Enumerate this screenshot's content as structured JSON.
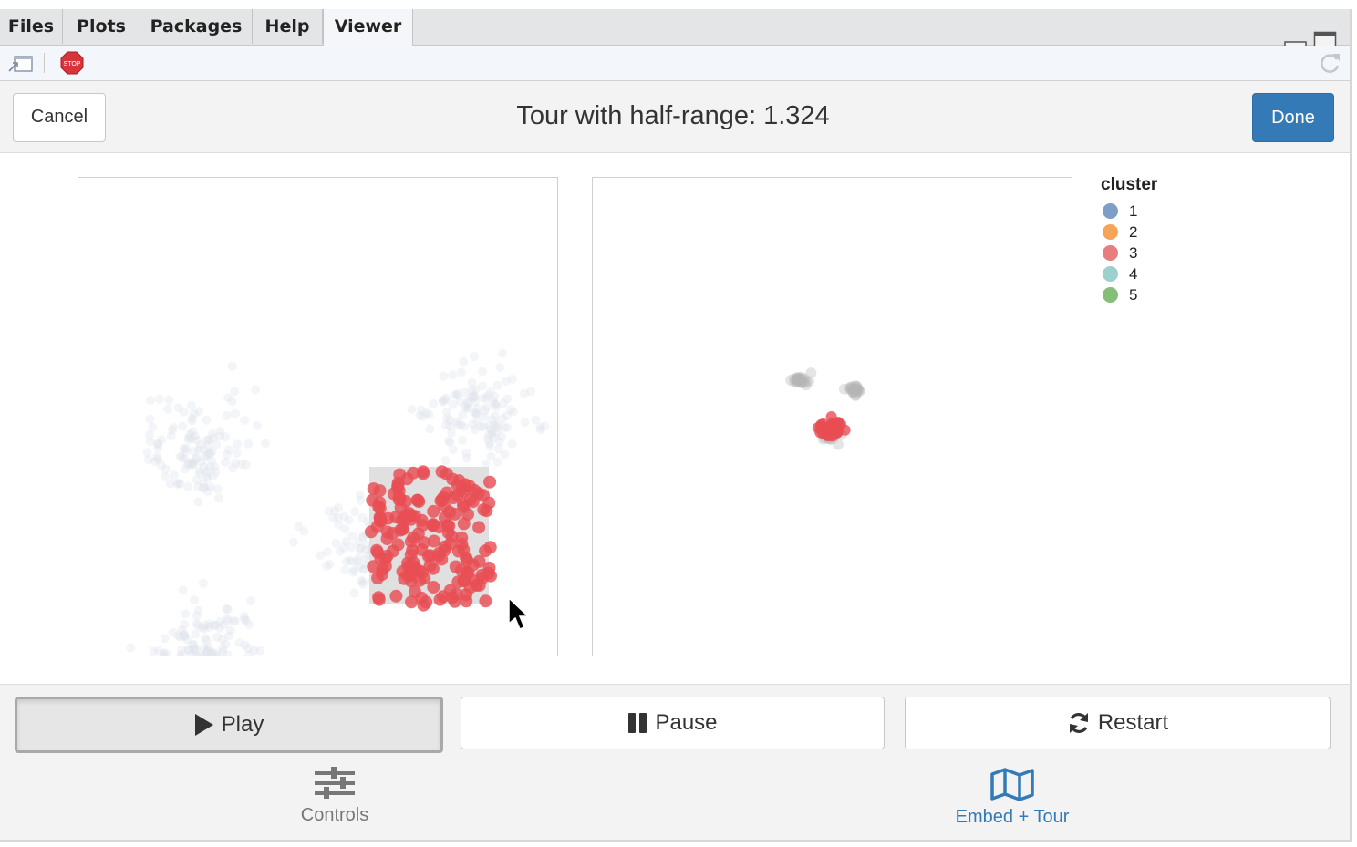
{
  "tabs": [
    {
      "label": "Files"
    },
    {
      "label": "Plots"
    },
    {
      "label": "Packages"
    },
    {
      "label": "Help"
    },
    {
      "label": "Viewer",
      "active": true
    }
  ],
  "toolbar": {
    "stop_icon": "stop-sign-icon",
    "stop_text": "STOP",
    "refresh_icon": "refresh-icon"
  },
  "header": {
    "cancel_label": "Cancel",
    "title": "Tour with half-range: 1.324",
    "done_label": "Done"
  },
  "legend": {
    "title": "cluster",
    "items": [
      {
        "label": "1",
        "color": "#7f9dc9"
      },
      {
        "label": "2",
        "color": "#f5a55a"
      },
      {
        "label": "3",
        "color": "#e87d80"
      },
      {
        "label": "4",
        "color": "#9cd0cc"
      },
      {
        "label": "5",
        "color": "#86bd78"
      }
    ]
  },
  "controls": {
    "play_label": "Play",
    "pause_label": "Pause",
    "restart_label": "Restart"
  },
  "bottom_nav": {
    "controls_label": "Controls",
    "embed_tour_label": "Embed + Tour",
    "active_color": "#337ab7",
    "inactive_color": "#777777"
  },
  "colors": {
    "selected_points": "#e84e54",
    "brush_box": "#e0e0e0",
    "faded_points": "#dde3ea",
    "primary": "#337ab7"
  }
}
